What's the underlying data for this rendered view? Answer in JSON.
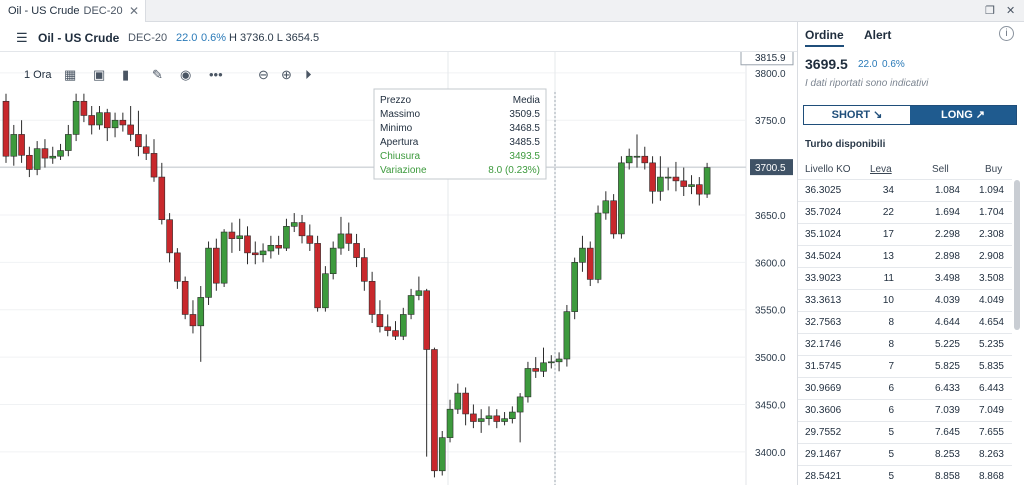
{
  "window": {
    "tab_title": "Oil - US Crude",
    "tab_contract": "DEC-20",
    "close_glyph": "✕",
    "restore_glyph": "❐",
    "close_window_glyph": "✕"
  },
  "instrument": {
    "name": "Oil - US Crude",
    "contract": "DEC-20",
    "change": "22.0",
    "change_pct": "0.6%",
    "high_low": "H 3736.0 L 3654.5"
  },
  "toolbar": {
    "timeframe": "1 Ora",
    "icons": [
      "calendar-icon",
      "bar-type-icon",
      "volume-icon",
      "draw-icon",
      "eye-icon",
      "more-icon",
      "zoom-out-icon",
      "zoom-in-icon",
      "play-icon"
    ]
  },
  "chart_data": {
    "type": "candlestick",
    "y_ticks": [
      "3800.0",
      "3750.0",
      "3700.0",
      "3650.0",
      "3600.0",
      "3550.0",
      "3500.0",
      "3450.0",
      "3400.0"
    ],
    "ylim": [
      3365,
      3822
    ],
    "cursor_price": "3815.9",
    "current_price": "3700.5",
    "colors": {
      "up": "#3d9a3d",
      "down": "#c8282c"
    },
    "tooltip": {
      "header_label": "Prezzo",
      "header_value": "Media",
      "rows": [
        {
          "label": "Massimo",
          "value": "3509.5"
        },
        {
          "label": "Minimo",
          "value": "3468.5"
        },
        {
          "label": "Apertura",
          "value": "3485.5"
        },
        {
          "label": "Chiusura",
          "value": "3493.5"
        },
        {
          "label": "Variazione",
          "value": "8.0 (0.23%)"
        }
      ]
    },
    "candles": [
      [
        3770,
        3712,
        3778,
        3705
      ],
      [
        3712,
        3735,
        3745,
        3702
      ],
      [
        3735,
        3713,
        3750,
        3705
      ],
      [
        3713,
        3698,
        3722,
        3690
      ],
      [
        3698,
        3720,
        3728,
        3692
      ],
      [
        3720,
        3710,
        3730,
        3700
      ],
      [
        3710,
        3712,
        3722,
        3704
      ],
      [
        3712,
        3718,
        3725,
        3708
      ],
      [
        3718,
        3735,
        3745,
        3712
      ],
      [
        3735,
        3770,
        3778,
        3728
      ],
      [
        3770,
        3755,
        3778,
        3748
      ],
      [
        3755,
        3745,
        3765,
        3735
      ],
      [
        3745,
        3758,
        3765,
        3740
      ],
      [
        3758,
        3742,
        3762,
        3728
      ],
      [
        3742,
        3750,
        3758,
        3732
      ],
      [
        3750,
        3745,
        3758,
        3738
      ],
      [
        3745,
        3735,
        3765,
        3728
      ],
      [
        3735,
        3722,
        3760,
        3712
      ],
      [
        3722,
        3715,
        3735,
        3708
      ],
      [
        3715,
        3690,
        3730,
        3685
      ],
      [
        3690,
        3645,
        3705,
        3640
      ],
      [
        3645,
        3610,
        3652,
        3600
      ],
      [
        3610,
        3580,
        3615,
        3572
      ],
      [
        3580,
        3545,
        3585,
        3540
      ],
      [
        3545,
        3533,
        3560,
        3525
      ],
      [
        3533,
        3563,
        3575,
        3495
      ],
      [
        3563,
        3615,
        3622,
        3555
      ],
      [
        3615,
        3578,
        3625,
        3570
      ],
      [
        3578,
        3632,
        3635,
        3574
      ],
      [
        3632,
        3625,
        3642,
        3610
      ],
      [
        3625,
        3628,
        3646,
        3612
      ],
      [
        3628,
        3610,
        3638,
        3598
      ],
      [
        3610,
        3608,
        3622,
        3598
      ],
      [
        3608,
        3612,
        3620,
        3600
      ],
      [
        3612,
        3618,
        3628,
        3604
      ],
      [
        3618,
        3615,
        3628,
        3608
      ],
      [
        3615,
        3638,
        3646,
        3612
      ],
      [
        3638,
        3642,
        3652,
        3632
      ],
      [
        3642,
        3628,
        3650,
        3620
      ],
      [
        3628,
        3620,
        3640,
        3612
      ],
      [
        3620,
        3552,
        3628,
        3548
      ],
      [
        3552,
        3588,
        3596,
        3548
      ],
      [
        3588,
        3615,
        3622,
        3582
      ],
      [
        3615,
        3630,
        3648,
        3608
      ],
      [
        3630,
        3620,
        3642,
        3612
      ],
      [
        3620,
        3605,
        3630,
        3595
      ],
      [
        3605,
        3580,
        3615,
        3570
      ],
      [
        3580,
        3545,
        3590,
        3536
      ],
      [
        3545,
        3532,
        3560,
        3526
      ],
      [
        3532,
        3528,
        3545,
        3522
      ],
      [
        3528,
        3522,
        3538,
        3518
      ],
      [
        3522,
        3545,
        3552,
        3518
      ],
      [
        3545,
        3565,
        3572,
        3540
      ],
      [
        3565,
        3570,
        3585,
        3560
      ],
      [
        3570,
        3508,
        3572,
        3395
      ],
      [
        3508,
        3380,
        3510,
        3373
      ],
      [
        3380,
        3415,
        3422,
        3375
      ],
      [
        3415,
        3445,
        3455,
        3410
      ],
      [
        3445,
        3462,
        3472,
        3440
      ],
      [
        3462,
        3440,
        3468,
        3428
      ],
      [
        3440,
        3432,
        3450,
        3425
      ],
      [
        3432,
        3435,
        3445,
        3420
      ],
      [
        3435,
        3438,
        3448,
        3428
      ],
      [
        3438,
        3432,
        3445,
        3425
      ],
      [
        3432,
        3435,
        3442,
        3428
      ],
      [
        3435,
        3442,
        3448,
        3430
      ],
      [
        3442,
        3458,
        3462,
        3410
      ],
      [
        3458,
        3488,
        3495,
        3452
      ],
      [
        3488,
        3485,
        3500,
        3478
      ],
      [
        3485,
        3494,
        3510,
        3479
      ],
      [
        3494,
        3495,
        3502,
        3488
      ],
      [
        3495,
        3498,
        3505,
        3485
      ],
      [
        3498,
        3548,
        3555,
        3490
      ],
      [
        3548,
        3600,
        3605,
        3540
      ],
      [
        3600,
        3615,
        3628,
        3590
      ],
      [
        3615,
        3582,
        3622,
        3575
      ],
      [
        3582,
        3652,
        3660,
        3578
      ],
      [
        3652,
        3665,
        3675,
        3645
      ],
      [
        3665,
        3630,
        3672,
        3625
      ],
      [
        3630,
        3705,
        3712,
        3625
      ],
      [
        3705,
        3712,
        3720,
        3698
      ],
      [
        3712,
        3712,
        3735,
        3700
      ],
      [
        3712,
        3705,
        3722,
        3698
      ],
      [
        3705,
        3675,
        3712,
        3662
      ],
      [
        3675,
        3690,
        3712,
        3665
      ],
      [
        3690,
        3690,
        3700,
        3676
      ],
      [
        3690,
        3686,
        3706,
        3675
      ],
      [
        3686,
        3680,
        3700,
        3670
      ],
      [
        3680,
        3682,
        3692,
        3672
      ],
      [
        3682,
        3672,
        3690,
        3660
      ],
      [
        3672,
        3700,
        3705,
        3668
      ]
    ]
  },
  "order_panel": {
    "tab_order": "Ordine",
    "tab_alert": "Alert",
    "info_glyph": "i",
    "price": "3699.5",
    "change": "22.0",
    "change_pct": "0.6%",
    "note": "I dati riportati sono indicativi",
    "short_label": "SHORT ↘",
    "long_label": "LONG ↗",
    "turbo_title": "Turbo disponibili",
    "columns": [
      "Livello KO",
      "Leva",
      "Sell",
      "Buy"
    ],
    "rows": [
      [
        "36.3025",
        "34",
        "1.084",
        "1.094"
      ],
      [
        "35.7024",
        "22",
        "1.694",
        "1.704"
      ],
      [
        "35.1024",
        "17",
        "2.298",
        "2.308"
      ],
      [
        "34.5024",
        "13",
        "2.898",
        "2.908"
      ],
      [
        "33.9023",
        "11",
        "3.498",
        "3.508"
      ],
      [
        "33.3613",
        "10",
        "4.039",
        "4.049"
      ],
      [
        "32.7563",
        "8",
        "4.644",
        "4.654"
      ],
      [
        "32.1746",
        "8",
        "5.225",
        "5.235"
      ],
      [
        "31.5745",
        "7",
        "5.825",
        "5.835"
      ],
      [
        "30.9669",
        "6",
        "6.433",
        "6.443"
      ],
      [
        "30.3606",
        "6",
        "7.039",
        "7.049"
      ],
      [
        "29.7552",
        "5",
        "7.645",
        "7.655"
      ],
      [
        "29.1467",
        "5",
        "8.253",
        "8.263"
      ],
      [
        "28.5421",
        "5",
        "8.858",
        "8.868"
      ]
    ]
  }
}
